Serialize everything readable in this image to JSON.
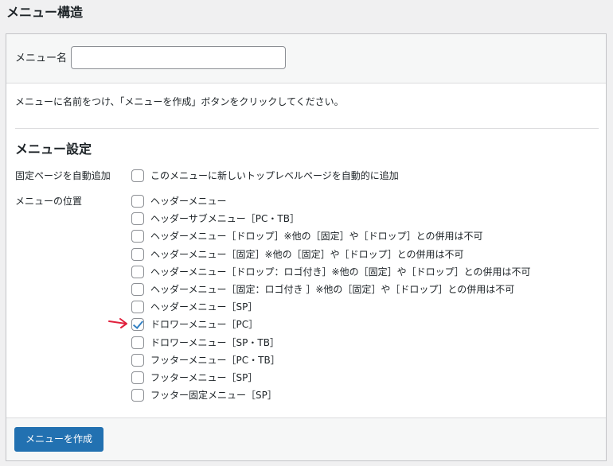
{
  "page_title": "メニュー構造",
  "menu_name": {
    "label": "メニュー名",
    "value": "",
    "placeholder": ""
  },
  "instruction": "メニューに名前をつけ、「メニューを作成」ボタンをクリックしてください。",
  "settings": {
    "title": "メニュー設定",
    "auto_add": {
      "label": "固定ページを自動追加",
      "option": {
        "label": "このメニューに新しいトップレベルページを自動的に追加",
        "checked": false
      }
    },
    "locations": {
      "label": "メニューの位置",
      "options": [
        {
          "label": "ヘッダーメニュー",
          "checked": false
        },
        {
          "label": "ヘッダーサブメニュー［PC・TB］",
          "checked": false
        },
        {
          "label": "ヘッダーメニュー［ドロップ］※他の［固定］や［ドロップ］との併用は不可",
          "checked": false
        },
        {
          "label": "ヘッダーメニュー［固定］※他の［固定］や［ドロップ］との併用は不可",
          "checked": false
        },
        {
          "label": "ヘッダーメニュー［ドロップ：ロゴ付き］※他の［固定］や［ドロップ］との併用は不可",
          "checked": false
        },
        {
          "label": "ヘッダーメニュー［固定：ロゴ付き ］※他の［固定］や［ドロップ］との併用は不可",
          "checked": false
        },
        {
          "label": "ヘッダーメニュー［SP］",
          "checked": false
        },
        {
          "label": "ドロワーメニュー［PC］",
          "checked": true
        },
        {
          "label": "ドロワーメニュー［SP・TB］",
          "checked": false
        },
        {
          "label": "フッターメニュー［PC・TB］",
          "checked": false
        },
        {
          "label": "フッターメニュー［SP］",
          "checked": false
        },
        {
          "label": "フッター固定メニュー［SP］",
          "checked": false
        }
      ]
    }
  },
  "create_button_label": "メニューを作成",
  "colors": {
    "accent": "#2271b1",
    "checkmark": "#3582c4",
    "annotation_arrow": "#e0203c"
  },
  "annotation": {
    "icon": "red-arrow-icon",
    "points_to": "ドロワーメニュー［PC］"
  }
}
